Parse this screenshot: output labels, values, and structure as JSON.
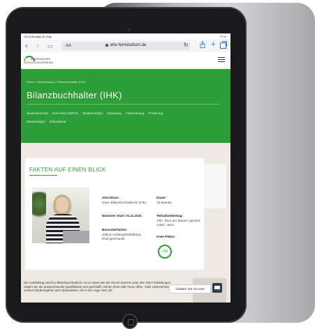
{
  "status": {
    "time": "15:15  Montag 18. Aug.",
    "battery": "73 %"
  },
  "browser": {
    "aa": "AA",
    "url": "ehv-fernstudium.de"
  },
  "logo": {
    "line1": "EUROPÄISCHER",
    "line2": "HOCHSCHULVERBUND"
  },
  "hero": {
    "breadcrumb": "Home  >  Weiterbildung  >  Bilanzbuchhalter (IHK)",
    "title": "Bilanzbuchhalter (IHK)",
    "nav": [
      "Studienkonzept",
      "EHV-liveCAMPUS",
      "Studienverlauf",
      "Zulassung",
      "Finanzierung",
      "Förderung",
      "Bewertungen",
      "Infomaterial"
    ]
  },
  "facts": {
    "heading": "FAKTEN AUF EINEN BLICK",
    "abschluss_label": "Abschluss:",
    "abschluss_value": "Gepr. Bilanzbuchhalter/in (IHK)",
    "dauer_label": "Dauer:",
    "dauer_value": "18 Monate",
    "start_label": "Nächster Start: 01.11.2021",
    "beitrag_label": "Teilnahmebetrag:",
    "beitrag_value": "149,- Euro pro Monat / gesamt 2.682,- Euro",
    "besonderheiten_label": "Besonderheiten:",
    "besonderheiten_value": "Online-Aufstiegsfortbildung iPad geschenkt!",
    "plaetze_label": "Freie Plätze:",
    "plaetze_value": "<50"
  },
  "description": "Die Ausbildung zum/zur Bilanzbuchhalter/in ist so etwas wie der Mount Everest unter den IHK-Fortbildungen. Haben Sie die anspruchsvolle Qualifikation erst geschafft, stehen Ihnen alle Türen offen. Viele Unternehmen suchen händeringend nach Spezialisten, die in der Lage sind, die",
  "chat": {
    "label": "Chatten Sie mit uns!"
  }
}
